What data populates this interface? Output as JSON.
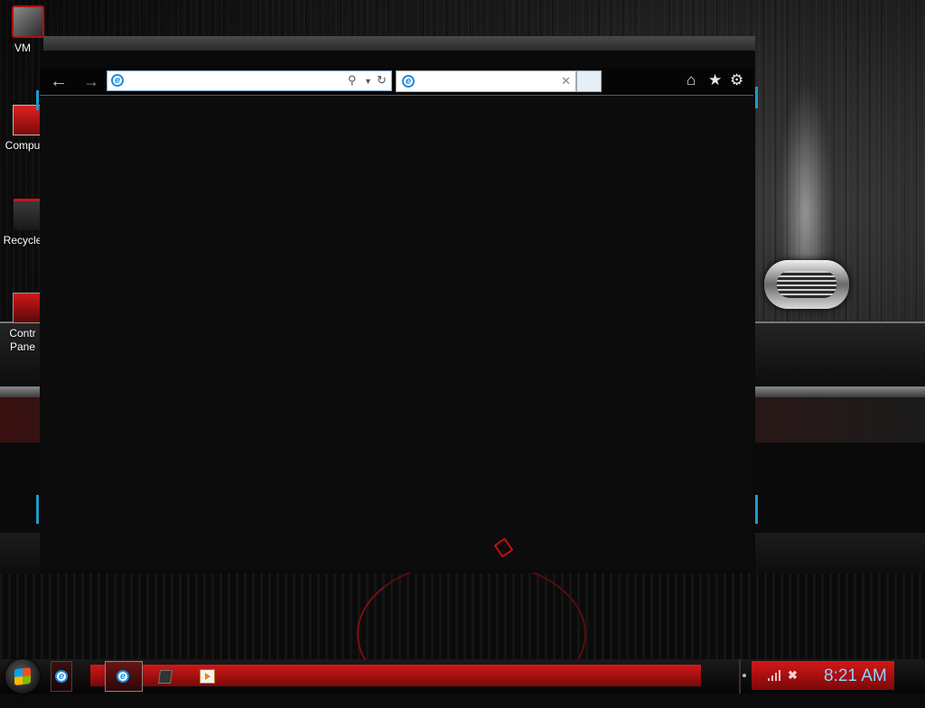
{
  "desktop": {
    "icons": [
      {
        "label": "VM"
      },
      {
        "label": "Compu"
      },
      {
        "label": "Recycle"
      },
      {
        "label": "Contr\nPane"
      }
    ]
  },
  "browser": {
    "address_value": "",
    "tab_title": "",
    "icons": {
      "back": "back-arrow-icon",
      "forward": "forward-arrow-icon",
      "search": "search-icon",
      "dropdown": "chevron-down-icon",
      "refresh": "refresh-icon",
      "close_tab": "close-icon",
      "home": "home-icon",
      "favorites": "star-icon",
      "tools": "gear-icon"
    }
  },
  "taskbar": {
    "clock": "8:21 AM"
  },
  "colors": {
    "accent_red": "#c01818",
    "frame_edge": "#1e9ac8",
    "clock_text": "#8ed2ff"
  }
}
